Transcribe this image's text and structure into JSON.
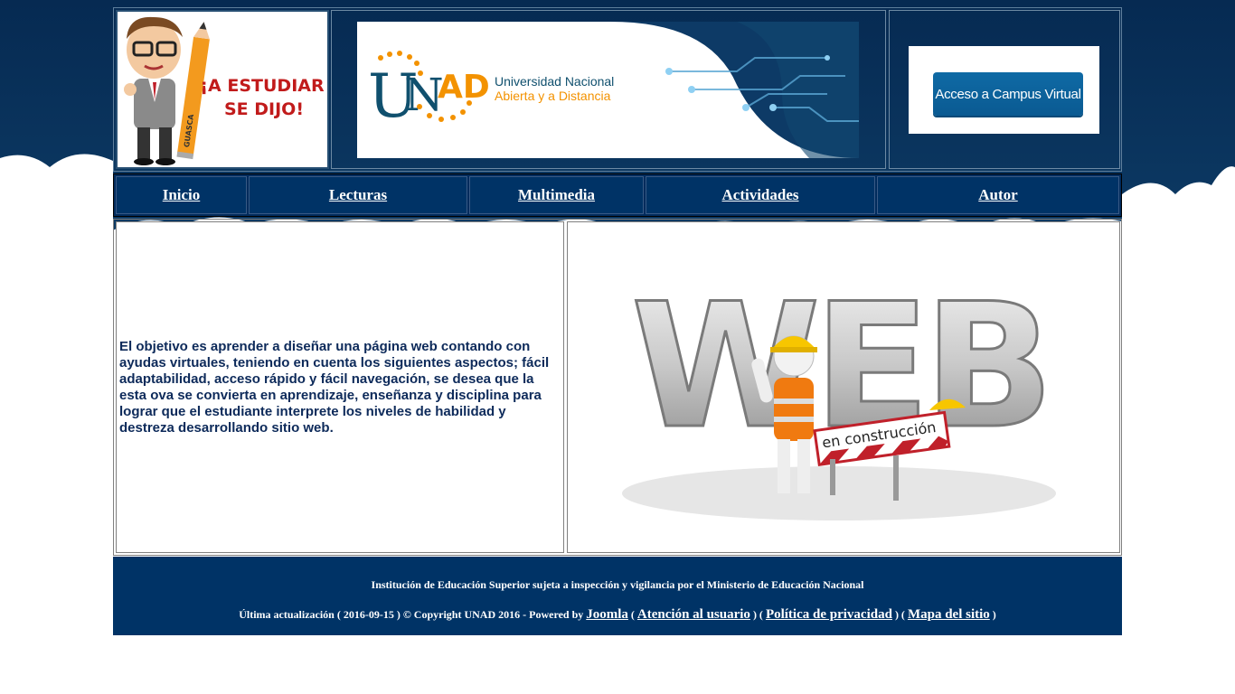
{
  "colors": {
    "nav_bg": "#003366",
    "footer_bg": "#003366",
    "sky": "#0d3a66",
    "text": "#0d2a5a",
    "unad_orange": "#f39200",
    "unad_blue": "#10506e"
  },
  "header": {
    "estudiar_text_line1": "¡A ESTUDIAR",
    "estudiar_text_line2": "SE DIJO!",
    "estudiar_pencil_text": "GUASCA",
    "logo_mark": "UNAD",
    "logo_mark_u": "U",
    "logo_mark_n": "N",
    "logo_mark_ad": "AD",
    "logo_name_line1": "Universidad Nacional",
    "logo_name_line2": "Abierta y a Distancia",
    "campus_button": "Acceso a Campus Virtual"
  },
  "nav": {
    "items": [
      {
        "label": "Inicio"
      },
      {
        "label": "Lecturas"
      },
      {
        "label": "Multimedia"
      },
      {
        "label": "Actividades"
      },
      {
        "label": "Autor"
      }
    ]
  },
  "main": {
    "body_text": "El objetivo es aprender a diseñar una página web contando con ayudas virtuales, teniendo en cuenta los siguientes aspectos; fácil adaptabilidad, acceso rápido y fácil navegación, se desea que la esta ova se convierta en aprendizaje, enseñanza y disciplina para lograr que el estudiante interprete los niveles de habilidad y destreza desarrollando sitio web.",
    "image_word": "WEB",
    "image_sign": "en construcción"
  },
  "footer": {
    "line1": "Institución de Educación Superior sujeta a inspección y vigilancia por el Ministerio de Educación Nacional",
    "line2_prefix": "Última actualización ( 2016-09-15 ) © Copyright UNAD 2016  - Powered by ",
    "link_joomla": "Joomla",
    "sep1": " ( ",
    "link_atencion": "Atención al usuario",
    "sep2": " ) ( ",
    "link_politica": "Política de privacidad",
    "sep3": " ) ( ",
    "link_mapa": "Mapa del sitio",
    "sep4": " )"
  }
}
